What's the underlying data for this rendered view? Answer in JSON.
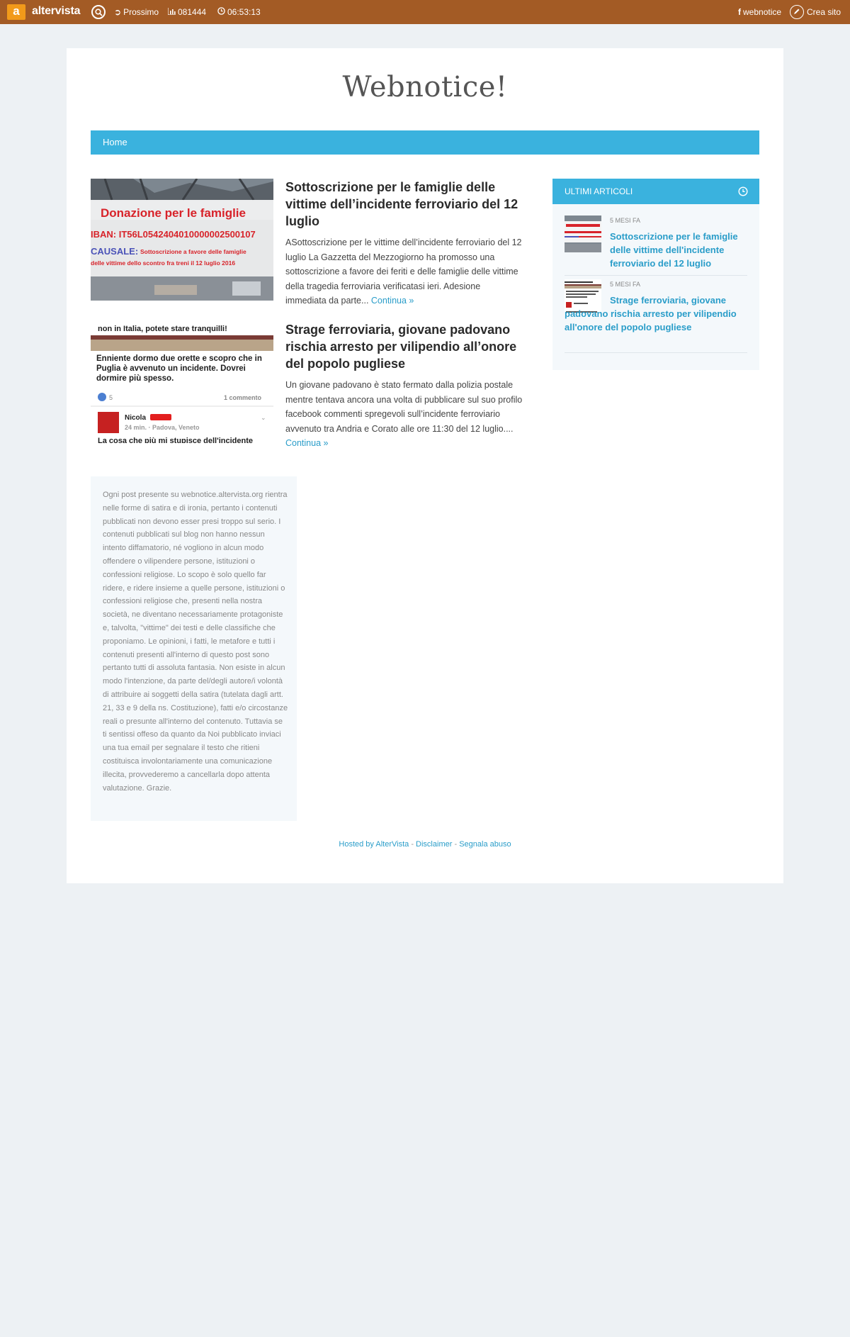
{
  "topbar": {
    "logo_letter": "a",
    "brand": "altervista",
    "prossimo": "Prossimo",
    "visits": "081444",
    "time": "06:53:13",
    "facebook": "webnotice",
    "crea_sito": "Crea sito",
    "bg_color": "#a35b25"
  },
  "site": {
    "title": "Webnotice!",
    "nav": {
      "home": "Home"
    }
  },
  "posts": [
    {
      "title": "Sottoscrizione per le famiglie delle vittime dell’incidente ferroviario del 12 luglio",
      "excerpt": "ASottoscrizione per le vittime dell’incidente ferroviario del 12 luglio La Gazzetta del Mezzogiorno ha promosso una sottoscrizione a favore dei feriti e delle famiglie delle vittime della tragedia ferroviaria verificatasi ieri. Adesione immediata da parte...",
      "more": "Continua »",
      "thumb": {
        "line1": "Donazione per le famiglie",
        "line2": "IBAN: IT56L0542404010000002500107",
        "line3": "CAUSALE:",
        "line3b": "Sottoscrizione a favore delle famiglie",
        "line4": "delle vittime dello scontro fra treni il 12 luglio 2016"
      }
    },
    {
      "title": "Strage ferroviaria, giovane padovano rischia arresto per vilipendio all’onore del popolo pugliese",
      "excerpt": "Un giovane padovano è stato fermato dalla polizia postale mentre tentava ancora una volta di pubblicare sul suo profilo facebook commenti spregevoli sull’incidente ferroviario avvenuto tra Andria e Corato alle ore 11:30 del 12 luglio....",
      "more": "Continua »",
      "thumb": {
        "line1": "non in Italia, potete stare tranquilli!",
        "line2": "Enniente dormo due orette e scopro che in Puglia è avvenuto un incidente.  Dovrei dormire più spesso.",
        "likes": "5",
        "comments": "1 commento",
        "name": "Nicola",
        "meta": "24 min. · Padova, Veneto",
        "line_last": "La cosa che più mi stupisce dell'incidente"
      }
    }
  ],
  "sidebar": {
    "heading": "ULTIMI ARTICOLI",
    "items": [
      {
        "meta": "5 MESI FA",
        "title": "Sottoscrizione per le famiglie delle vittime dell'incidente ferroviario del 12 luglio"
      },
      {
        "meta": "5 MESI FA",
        "title": "Strage ferroviaria, giovane padovano rischia arresto per vilipendio all'onore del popolo pugliese"
      }
    ]
  },
  "disclaimer": {
    "text": "Ogni post presente su webnotice.altervista.org rientra nelle forme di satira e di ironia, pertanto i contenuti pubblicati non devono esser presi troppo sul serio. I contenuti pubblicati sul blog non hanno nessun intento diffamatorio, né vogliono in alcun modo offendere o vilipendere persone, istituzioni o confessioni religiose. Lo scopo è solo quello far ridere, e ridere insieme a quelle persone, istituzioni o confessioni religiose che, presenti nella nostra società, ne diventano necessariamente protagoniste e, talvolta, \"vittime\" dei testi e delle classifiche che proponiamo. Le opinioni, i fatti, le metafore e tutti i contenuti presenti all'interno di questo post sono pertanto tutti di assoluta fantasia. Non esiste in alcun modo l'intenzione, da parte del/degli autore/i volontà di attribuire ai soggetti della satira (tutelata dagli artt. 21, 33 e 9 della ns. Costituzione), fatti e/o circostanze reali o presunte all'interno del contenuto. Tuttavia se ti sentissi offeso da quanto da Noi pubblicato inviaci una tua email per segnalare il testo che ritieni costituisca involontariamente una comunicazione illecita, provvederemo a cancellarla dopo attenta valutazione. Grazie."
  },
  "footer": {
    "hosted": "Hosted by AlterVista",
    "sep": "-",
    "disclaimer": "Disclaimer",
    "abuse": "Segnala abuso"
  },
  "colors": {
    "accent": "#3ab2de",
    "link": "#2a9dc9",
    "topbar": "#a35b25",
    "logo": "#f29a1a"
  }
}
